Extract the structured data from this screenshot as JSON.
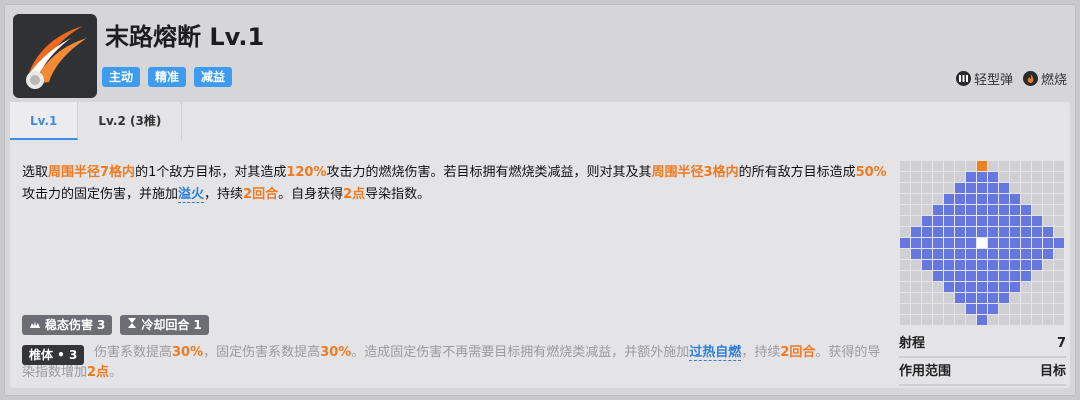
{
  "skill": {
    "title": "末路熔断 Lv.1",
    "tags": [
      "主动",
      "精准",
      "减益"
    ],
    "elements": [
      {
        "icon": "light-ammo-icon",
        "label": "轻型弹"
      },
      {
        "icon": "burn-icon",
        "label": "燃烧"
      }
    ]
  },
  "tabs": [
    {
      "label": "Lv.1",
      "active": true
    },
    {
      "label": "Lv.2 (3椎)",
      "active": false
    }
  ],
  "description": {
    "p1": "选取",
    "h1": "周围半径7格内",
    "p2": "的1个敌方目标，对其造成",
    "h2": "120%",
    "p3": "攻击力的燃烧伤害。若目标拥有燃烧类减益，则对其及其",
    "h3": "周围半径3格内",
    "p4": "的所有敌方目标造成",
    "h4": "50%",
    "p5": "攻击力的固定伤害，并施加",
    "k1": "溢火",
    "p6": "，持续",
    "h5": "2回合",
    "p7": "。自身获得",
    "h6": "2点",
    "p8": "导染指数。"
  },
  "stats": [
    {
      "icon": "stable-damage-icon",
      "label": "稳态伤害",
      "value": "3"
    },
    {
      "icon": "hourglass-icon",
      "label": "冷却回合",
      "value": "1"
    }
  ],
  "upgrade": {
    "badge": "椎体 • 3",
    "t1": "伤害系数提高",
    "h1": "30%",
    "t2": "，固定伤害系数提高",
    "h2": "30%",
    "t3": "。造成固定伤害不再需要目标拥有燃烧类减益，并额外施加",
    "k1": "过热自燃",
    "t4": "，持续",
    "h3": "2回合",
    "t5": "。获得的导染指数增加",
    "h4": "2点",
    "t6": "。"
  },
  "range": {
    "rows": [
      {
        "label": "射程",
        "value": "7"
      },
      {
        "label": "作用范围",
        "value": "目标"
      }
    ]
  },
  "colors": {
    "tag": "#3d9bf0",
    "highlight": "#f07a20",
    "keyword": "#2f7fd8",
    "grid_empty": "#cfcfd4",
    "grid_area": "#6677e0",
    "grid_origin": "#f08020",
    "grid_center": "#ffffff"
  }
}
